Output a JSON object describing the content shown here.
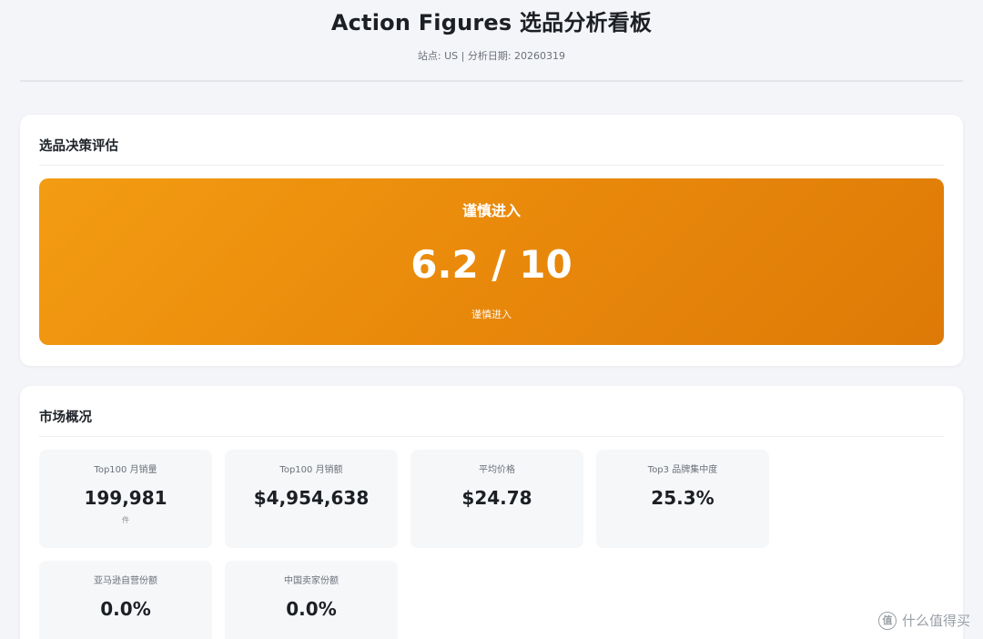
{
  "header": {
    "title": "Action Figures 选品分析看板",
    "subtitle": "站点: US | 分析日期: 20260319"
  },
  "decision": {
    "section_title": "选品决策评估",
    "label": "谨慎进入",
    "score": "6.2 / 10",
    "note": "谨慎进入",
    "colors": {
      "gradient_start": "#f39c12",
      "gradient_end": "#dd7a07"
    }
  },
  "market": {
    "section_title": "市场概况",
    "metrics": [
      {
        "label": "Top100 月销量",
        "value": "199,981",
        "unit": "件"
      },
      {
        "label": "Top100 月销额",
        "value": "$4,954,638",
        "unit": ""
      },
      {
        "label": "平均价格",
        "value": "$24.78",
        "unit": ""
      },
      {
        "label": "Top3 品牌集中度",
        "value": "25.3%",
        "unit": ""
      },
      {
        "label": "亚马逊自营份额",
        "value": "0.0%",
        "unit": ""
      },
      {
        "label": "中国卖家份额",
        "value": "0.0%",
        "unit": ""
      }
    ]
  },
  "watermark": {
    "logo_text": "值",
    "text": "什么值得买"
  }
}
